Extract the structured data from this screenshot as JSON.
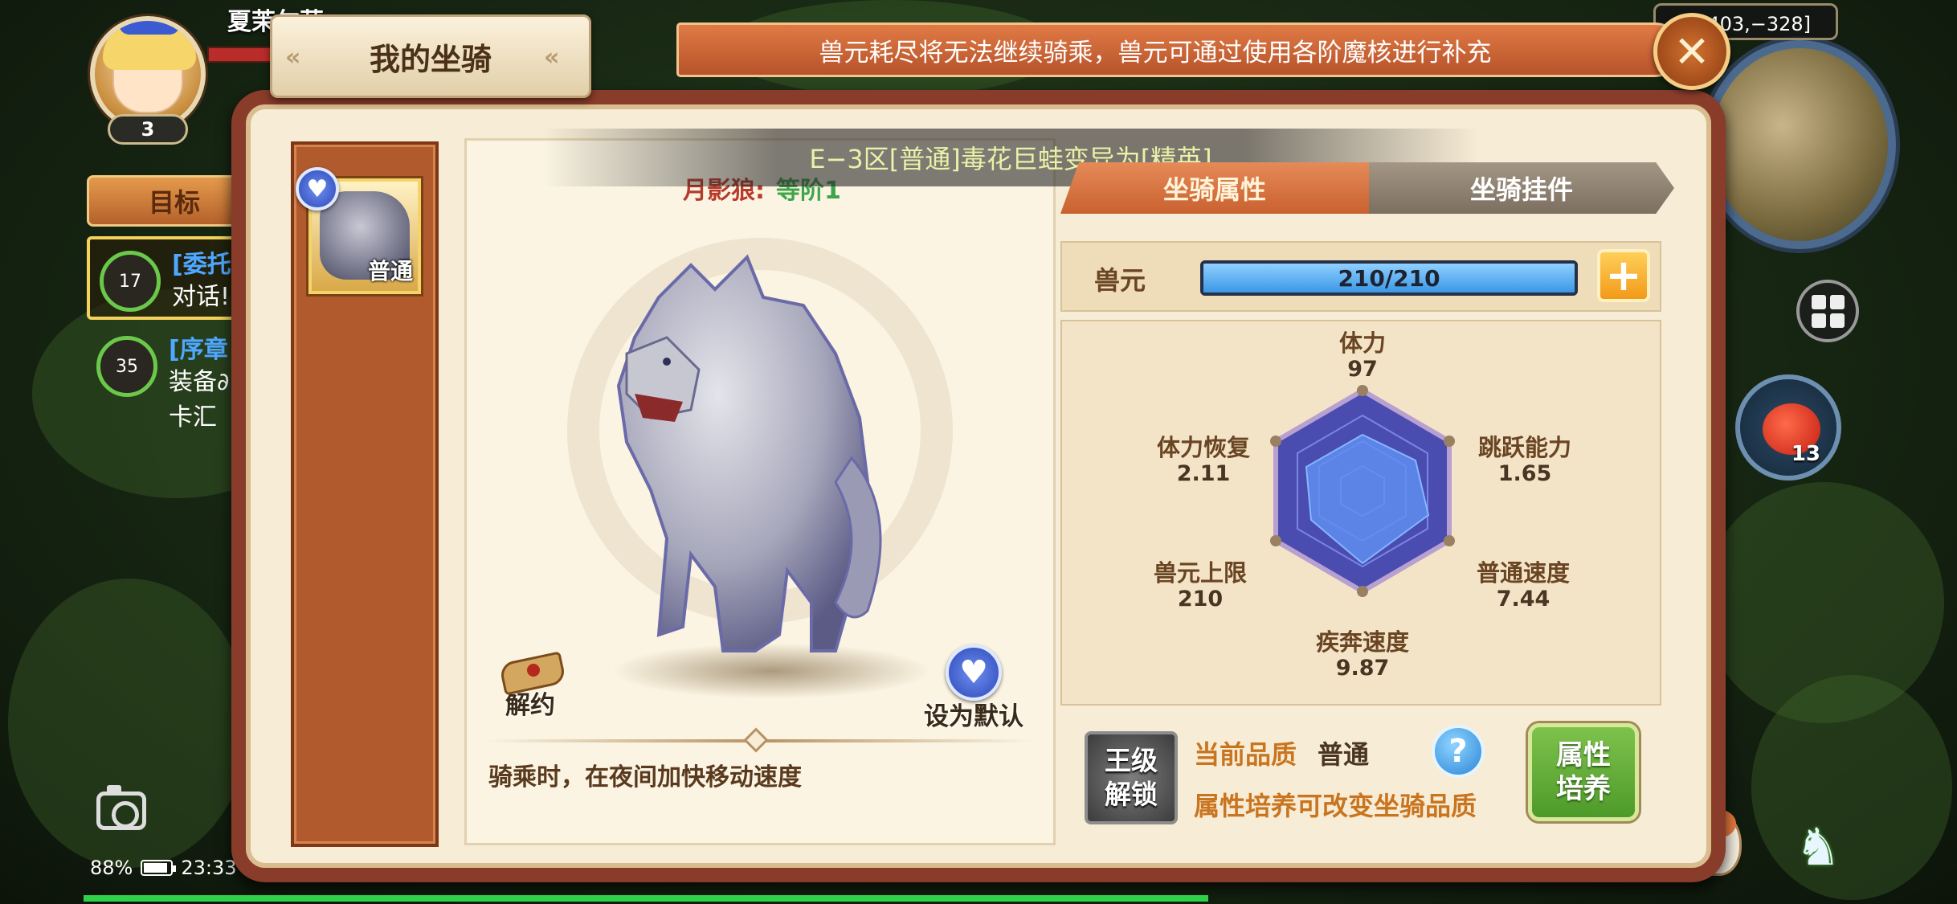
{
  "player": {
    "name": "夏茉尔莉",
    "level": "3"
  },
  "quests": {
    "tab_label": "目标",
    "items": [
      {
        "level": "17",
        "title": "[委托",
        "desc": "对话!"
      },
      {
        "level": "35",
        "title": "[序章",
        "desc": "装备∂\n卡汇"
      }
    ]
  },
  "status_bar": {
    "battery": "88%",
    "time": "23:33"
  },
  "hud_right": {
    "coords": "区[403,−328]",
    "item_count": "13",
    "item_icon": "tomato-icon"
  },
  "panel": {
    "title": "我的坐骑",
    "notice": "兽元耗尽将无法继续骑乘，兽元可通过使用各阶魔核进行补充",
    "close_icon": "close-icon"
  },
  "system_message": "E−3区[普通]毒花巨蛙变异为[精英]",
  "mount": {
    "card_grade": "普通",
    "name": "月影狼:",
    "rank": "等阶1",
    "release_label": "解约",
    "set_default_label": "设为默认",
    "skill_desc": "骑乘时，在夜间加快移动速度"
  },
  "tabs": {
    "attributes": "坐骑属性",
    "accessories": "坐骑挂件"
  },
  "energy": {
    "label": "兽元",
    "value": "210/210",
    "fill_fraction": 1.0
  },
  "stats": {
    "stamina": {
      "name": "体力",
      "value": "97"
    },
    "jump": {
      "name": "跳跃能力",
      "value": "1.65"
    },
    "normal_speed": {
      "name": "普通速度",
      "value": "7.44"
    },
    "sprint_speed": {
      "name": "疾奔速度",
      "value": "9.87"
    },
    "energy_max": {
      "name": "兽元上限",
      "value": "210"
    },
    "stamina_regen": {
      "name": "体力恢复",
      "value": "2.11"
    }
  },
  "quality": {
    "unlock_label": "王级\n解锁",
    "current_label": "当前品质",
    "current_value": "普通",
    "hint": "属性培养可改变坐骑品质",
    "cultivate_label": "属性\n培养"
  },
  "colors": {
    "panel_border": "#8a3c2a",
    "tab_active": "#d26f3c",
    "energy_fill": "#3b97e6",
    "radar_fill": "#4a64d8",
    "cultivate_green": "#5fae35"
  }
}
